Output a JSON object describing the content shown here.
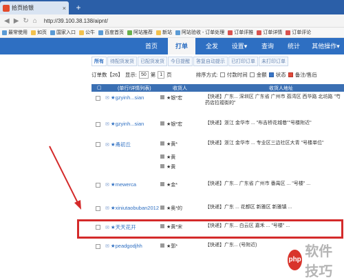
{
  "browser": {
    "tab_title": "拾页拾银",
    "tab_close": "×",
    "new_tab": "+",
    "url": "http://39.100.38.138/aipnt/",
    "bookmarks": [
      "最常使用",
      "如页",
      "国家入口",
      "公牛",
      "百度首页",
      "阿站推荐",
      "新站",
      "阿站验收 - 订单处理",
      "订单评推",
      "订单详情",
      "订单评论"
    ]
  },
  "appnav": {
    "items": [
      "首页",
      "打单",
      "全发",
      "设置▾",
      "查询",
      "统计",
      "其他操作▾"
    ]
  },
  "subtabs": [
    "所有",
    "待配货发货",
    "已配货发货",
    "今日提醒",
    "答复自动提示",
    "已打印订单",
    "未打印订单"
  ],
  "filter": {
    "total_text": "订单数【26】",
    "per_page_label": "显示:",
    "per_page_value": "50",
    "page_prefix": "第",
    "page_value": "1",
    "page_suffix": "页",
    "sort_label": "排序方式:",
    "sort_options": [
      "付款时间",
      "金额",
      "状态",
      "备注/售后"
    ]
  },
  "table": {
    "headers": [
      "(单行/详情列表)",
      "收货人",
      "收货人地址"
    ],
    "rows": [
      {
        "customer": "★gzyinh...sian",
        "pay": "★银*宏",
        "addr": "【快递】广东... 深圳区 广东省 广州市 荔湾区 西华路 北坊路 \"芍药店拉福街的\""
      },
      {
        "customer": "★gzyinh...sian",
        "pay": "★银*宏",
        "addr": "【快递】浙江 金华市 ... \"布吉桥花城巷\"\"号楼附近\""
      },
      {
        "customer": "★甬初丘",
        "pay": "★黄*",
        "addr": "【快递】浙江 金华市 ... 专业区三边社区大青 \"号楼单位\""
      },
      {
        "customer": "★mewerca",
        "pay": "★金*",
        "addr": "【快递】广东... 广东省 广州市 番禺区 ... \"号楼\" ..."
      },
      {
        "customer": "★xiniutaobuban2012",
        "pay": "★奥*的",
        "addr": "【快递】广东 ... 花都区 新雅区 新雅镇 ..."
      },
      {
        "customer": "★天天花开",
        "pay": "★黄*宋",
        "addr": "【快递】广东... 白云区 嘉禾 ... \"号楼\" ..."
      },
      {
        "customer": "★peadgodjhh",
        "pay": "★郭*",
        "addr": "【快递】广东... (号附近)"
      }
    ],
    "extra_rows": [
      "★黄",
      "★黄"
    ]
  },
  "watermark": {
    "logo": "php",
    "text": "软件技巧"
  },
  "colors": {
    "nav_blue": "#2e6fc2",
    "highlight_red": "#d42a2a",
    "tab_bar": "#2b5fa8"
  }
}
